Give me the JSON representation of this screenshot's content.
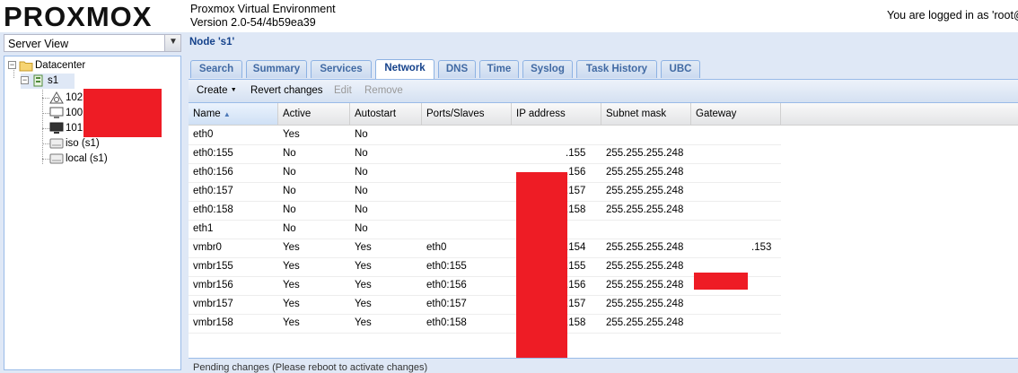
{
  "header": {
    "logo_text": "PROXMOX",
    "product_name": "Proxmox Virtual Environment",
    "version": "Version 2.0-54/4b59ea39",
    "login_text": "You are logged in as 'root@"
  },
  "left": {
    "view_selector": "Server View",
    "tree": {
      "datacenter": "Datacenter",
      "node": "s1",
      "vms": [
        {
          "id": "102",
          "icon": "template-icon"
        },
        {
          "id": "100",
          "icon": "vm-stopped-icon"
        },
        {
          "id": "101",
          "icon": "vm-running-icon"
        }
      ],
      "storages": [
        {
          "label": "iso (s1)"
        },
        {
          "label": "local (s1)"
        }
      ]
    }
  },
  "right": {
    "node_title": "Node 's1'",
    "tabs": [
      {
        "label": "Search"
      },
      {
        "label": "Summary"
      },
      {
        "label": "Services"
      },
      {
        "label": "Network",
        "active": true
      },
      {
        "label": "DNS"
      },
      {
        "label": "Time"
      },
      {
        "label": "Syslog"
      },
      {
        "label": "Task History"
      },
      {
        "label": "UBC"
      }
    ],
    "toolbar": {
      "create": "Create",
      "revert": "Revert changes",
      "edit": "Edit",
      "remove": "Remove"
    },
    "grid": {
      "columns": [
        "Name",
        "Active",
        "Autostart",
        "Ports/Slaves",
        "IP address",
        "Subnet mask",
        "Gateway"
      ],
      "rows": [
        [
          "eth0",
          "Yes",
          "No",
          "",
          "",
          "",
          ""
        ],
        [
          "eth0:155",
          "No",
          "No",
          "",
          ".155",
          "255.255.255.248",
          ""
        ],
        [
          "eth0:156",
          "No",
          "No",
          "",
          ".156",
          "255.255.255.248",
          ""
        ],
        [
          "eth0:157",
          "No",
          "No",
          "",
          ".157",
          "255.255.255.248",
          ""
        ],
        [
          "eth0:158",
          "No",
          "No",
          "",
          ".158",
          "255.255.255.248",
          ""
        ],
        [
          "eth1",
          "No",
          "No",
          "",
          "",
          "",
          ""
        ],
        [
          "vmbr0",
          "Yes",
          "Yes",
          "eth0",
          ".154",
          "255.255.255.248",
          ".153"
        ],
        [
          "vmbr155",
          "Yes",
          "Yes",
          "eth0:155",
          ".155",
          "255.255.255.248",
          ""
        ],
        [
          "vmbr156",
          "Yes",
          "Yes",
          "eth0:156",
          ".156",
          "255.255.255.248",
          ""
        ],
        [
          "vmbr157",
          "Yes",
          "Yes",
          "eth0:157",
          ".157",
          "255.255.255.248",
          ""
        ],
        [
          "vmbr158",
          "Yes",
          "Yes",
          "eth0:158",
          ".158",
          "255.255.255.248",
          ""
        ]
      ]
    },
    "status_text": "Pending changes (Please reboot to activate changes)"
  },
  "colors": {
    "redaction": "#ee1c25",
    "panel_bg": "#dfe8f6",
    "accent_text": "#15428b"
  }
}
